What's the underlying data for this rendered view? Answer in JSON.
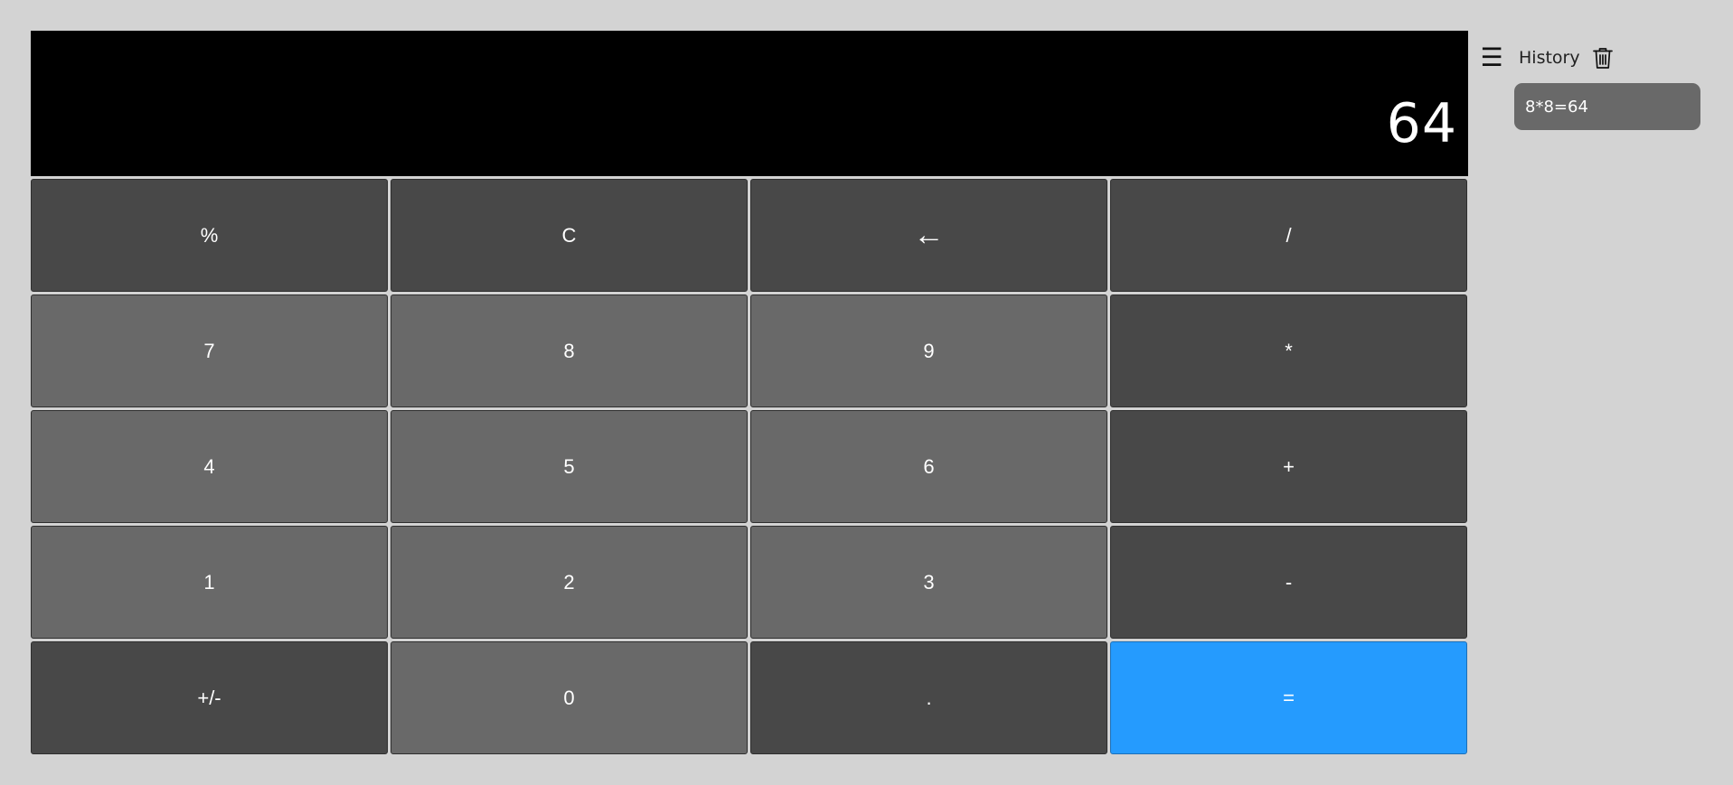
{
  "display": {
    "value": "64"
  },
  "keypad": {
    "rows": [
      [
        {
          "label": "%",
          "style": "dark",
          "name": "percent-button"
        },
        {
          "label": "C",
          "style": "dark",
          "name": "clear-button"
        },
        {
          "label": "←",
          "style": "dark",
          "name": "backspace-button"
        },
        {
          "label": "/",
          "style": "dark",
          "name": "divide-button"
        }
      ],
      [
        {
          "label": "7",
          "style": "light",
          "name": "digit-7-button"
        },
        {
          "label": "8",
          "style": "light",
          "name": "digit-8-button"
        },
        {
          "label": "9",
          "style": "light",
          "name": "digit-9-button"
        },
        {
          "label": "*",
          "style": "dark",
          "name": "multiply-button"
        }
      ],
      [
        {
          "label": "4",
          "style": "light",
          "name": "digit-4-button"
        },
        {
          "label": "5",
          "style": "light",
          "name": "digit-5-button"
        },
        {
          "label": "6",
          "style": "light",
          "name": "digit-6-button"
        },
        {
          "label": "+",
          "style": "dark",
          "name": "add-button"
        }
      ],
      [
        {
          "label": "1",
          "style": "light",
          "name": "digit-1-button"
        },
        {
          "label": "2",
          "style": "light",
          "name": "digit-2-button"
        },
        {
          "label": "3",
          "style": "light",
          "name": "digit-3-button"
        },
        {
          "label": "-",
          "style": "dark",
          "name": "subtract-button"
        }
      ],
      [
        {
          "label": "+/-",
          "style": "dark",
          "name": "negate-button"
        },
        {
          "label": "0",
          "style": "light",
          "name": "digit-0-button"
        },
        {
          "label": ".",
          "style": "dark",
          "name": "decimal-button"
        },
        {
          "label": "=",
          "style": "blue",
          "name": "equals-button"
        }
      ]
    ]
  },
  "history": {
    "menu_icon": "hamburger-menu-icon",
    "title": "History",
    "clear_icon": "trash-icon",
    "items": [
      "8*8=64"
    ]
  },
  "colors": {
    "background": "#d3d3d3",
    "display_background": "#000000",
    "key_light": "#696969",
    "key_dark": "#484848",
    "key_accent": "#259bfe"
  }
}
